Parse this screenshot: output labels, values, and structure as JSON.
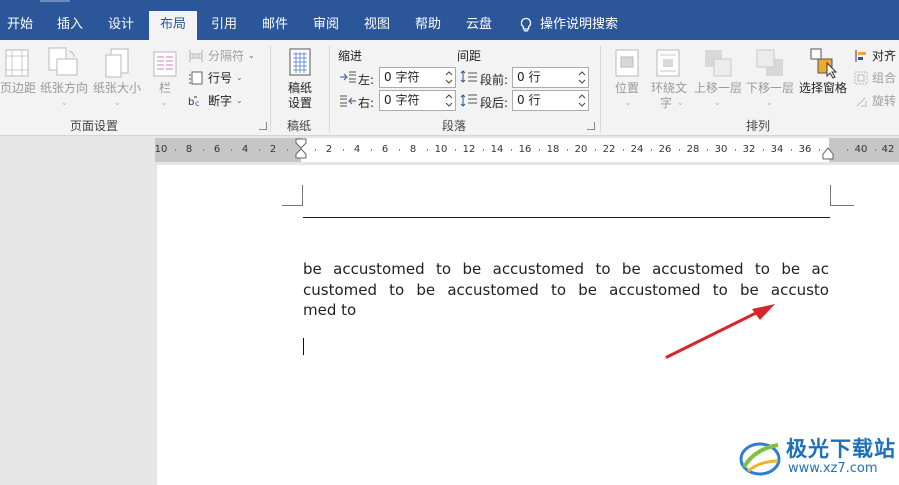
{
  "tabs": [
    {
      "label": "开始"
    },
    {
      "label": "插入"
    },
    {
      "label": "设计"
    },
    {
      "label": "布局",
      "active": true
    },
    {
      "label": "引用"
    },
    {
      "label": "邮件"
    },
    {
      "label": "审阅"
    },
    {
      "label": "视图"
    },
    {
      "label": "帮助"
    },
    {
      "label": "云盘"
    }
  ],
  "tell_me": "操作说明搜索",
  "ribbon": {
    "page_setup": {
      "group_label": "页面设置",
      "margins": "页边距",
      "orientation": "纸张方向",
      "size": "纸张大小",
      "columns": "栏",
      "breaks": "分隔符",
      "line_numbers": "行号",
      "hyphenation": "断字"
    },
    "manuscript": {
      "group_label": "稿纸",
      "button_line1": "稿纸",
      "button_line2": "设置"
    },
    "paragraph": {
      "group_label": "段落",
      "indent_header": "缩进",
      "spacing_header": "间距",
      "left_label": "左:",
      "left_value": "0 字符",
      "right_label": "右:",
      "right_value": "0 字符",
      "before_label": "段前:",
      "before_value": "0 行",
      "after_label": "段后:",
      "after_value": "0 行"
    },
    "arrange": {
      "group_label": "排列",
      "position": "位置",
      "wrap_line1": "环绕文",
      "wrap_line2": "字",
      "bring_forward": "上移一层",
      "send_backward": "下移一层",
      "selection_pane": "选择窗格",
      "align": "对齐",
      "group": "组合",
      "rotate": "旋转"
    }
  },
  "ruler": {
    "labels": [
      "10",
      "8",
      "6",
      "4",
      "2",
      "2",
      "4",
      "6",
      "8",
      "10",
      "12",
      "14",
      "16",
      "18",
      "20",
      "22",
      "24",
      "26",
      "28",
      "30",
      "32",
      "34",
      "36",
      "40",
      "42"
    ]
  },
  "document": {
    "lines": [
      "be accustomed to be accustomed to be accustomed to be ac",
      "customed to be accustomed to be accustomed to be accusto",
      "med to"
    ]
  },
  "watermark": {
    "title": "极光下载站",
    "url": "www.xz7.com"
  },
  "colors": {
    "tab_bar": "#2b579a",
    "ribbon": "#f3f3f3",
    "arrow": "#d9252a",
    "watermark": "#1f6fb8"
  }
}
